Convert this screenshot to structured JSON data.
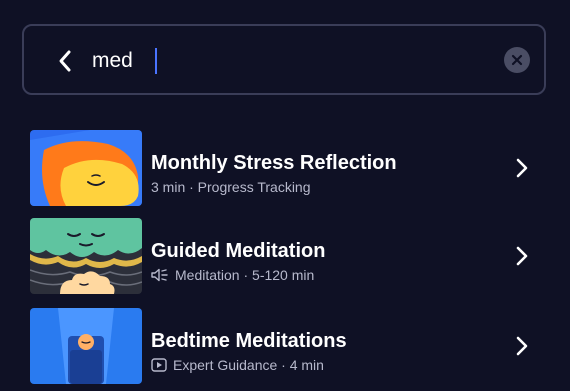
{
  "search": {
    "query": "med"
  },
  "results": [
    {
      "title": "Monthly Stress Reflection",
      "meta": "3 min · Progress Tracking",
      "meta_icon": "",
      "thumb_icon": "smiling-sun-illustration"
    },
    {
      "title": "Guided Meditation",
      "meta": "Meditation · 5-120 min",
      "meta_icon": "speaker-icon",
      "thumb_icon": "meditating-face-illustration"
    },
    {
      "title": "Bedtime Meditations",
      "meta": "Expert Guidance · 4 min",
      "meta_icon": "play-icon",
      "thumb_icon": "bedtime-figure-illustration"
    }
  ],
  "colors": {
    "background": "#0f1125",
    "border": "#3a3d58",
    "accent": "#4a74ff",
    "meta_text": "#b7b9cc"
  }
}
